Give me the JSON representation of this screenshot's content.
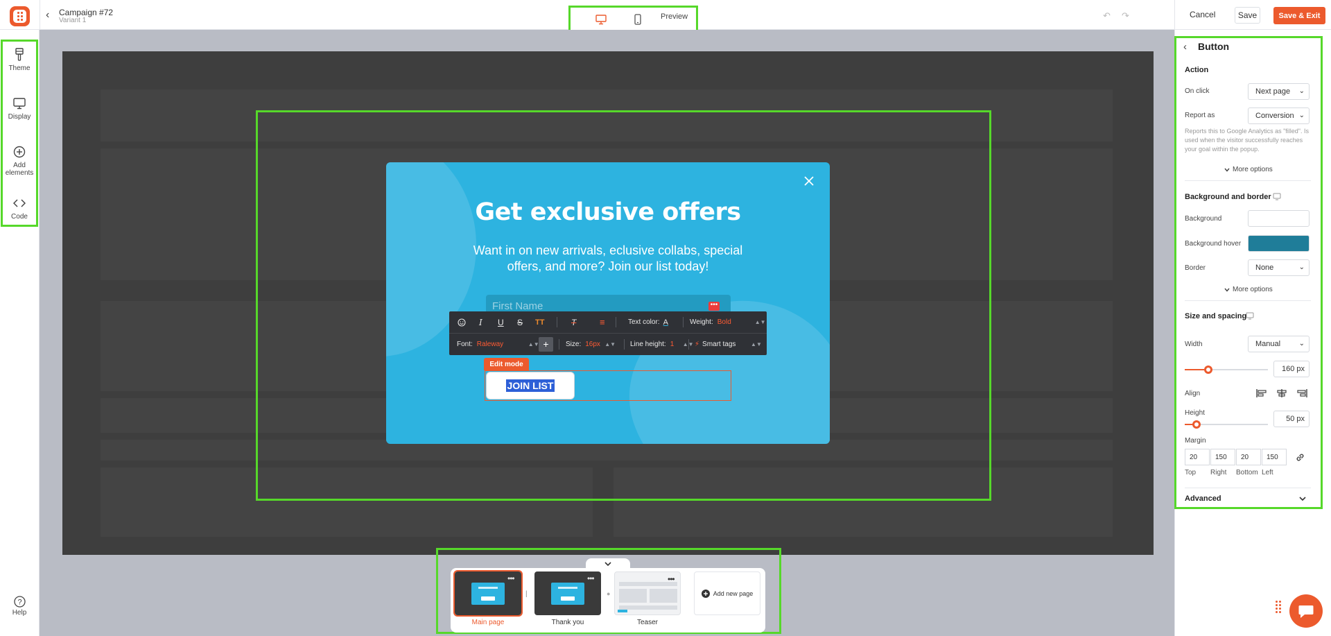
{
  "header": {
    "campaign_title": "Campaign #72",
    "variant": "Variant 1",
    "preview_label": "Preview",
    "cancel_label": "Cancel",
    "save_label": "Save",
    "save_exit_label": "Save & Exit"
  },
  "sidebar": {
    "items": [
      {
        "label": "Theme",
        "icon": "brush-icon"
      },
      {
        "label": "Display",
        "icon": "monitor-icon"
      },
      {
        "label": "Add elements",
        "icon": "plus-circle-icon"
      },
      {
        "label": "Code",
        "icon": "code-icon"
      }
    ],
    "help_label": "Help"
  },
  "popup": {
    "title": "Get exclusive offers",
    "subtitle": "Want in on new arrivals, eclusive collabs, special offers, and more? Join our list today!",
    "first_name_placeholder": "First Name",
    "button_text": "JOIN LIST",
    "edit_mode_label": "Edit mode"
  },
  "toolbar": {
    "text_color_label": "Text color:",
    "weight_label": "Weight:",
    "weight_value": "Bold",
    "font_label": "Font:",
    "font_value": "Raleway",
    "size_label": "Size:",
    "size_value": "16px",
    "line_height_label": "Line height:",
    "line_height_value": "1",
    "smart_tags_label": "Smart tags"
  },
  "pages": {
    "items": [
      {
        "label": "Main page",
        "active": true
      },
      {
        "label": "Thank you",
        "active": false
      },
      {
        "label": "Teaser",
        "active": false
      }
    ],
    "add_label": "Add new page"
  },
  "panel": {
    "title": "Button",
    "action_heading": "Action",
    "on_click_label": "On click",
    "on_click_value": "Next page",
    "report_as_label": "Report as",
    "report_as_value": "Conversion",
    "report_note": "Reports this to Google Analytics as \"filled\". Is used when the visitor successfully reaches your goal within the popup.",
    "more_options_label": "More options",
    "bg_heading": "Background and border",
    "background_label": "Background",
    "background_hover_label": "Background hover",
    "background_hover_color": "#1f7d99",
    "border_label": "Border",
    "border_value": "None",
    "size_heading": "Size and spacing",
    "width_label": "Width",
    "width_mode": "Manual",
    "width_value": "160 px",
    "width_slider_fraction": 0.28,
    "align_label": "Align",
    "height_label": "Height",
    "height_value": "50 px",
    "height_slider_fraction": 0.14,
    "margin_label": "Margin",
    "margins": [
      {
        "value": "20",
        "label": "Top"
      },
      {
        "value": "150",
        "label": "Right"
      },
      {
        "value": "20",
        "label": "Bottom"
      },
      {
        "value": "150",
        "label": "Left"
      }
    ],
    "advanced_heading": "Advanced"
  },
  "colors": {
    "accent": "#ec5a2d",
    "popup_bg": "#2db3e0",
    "highlight": "#56d82a"
  }
}
